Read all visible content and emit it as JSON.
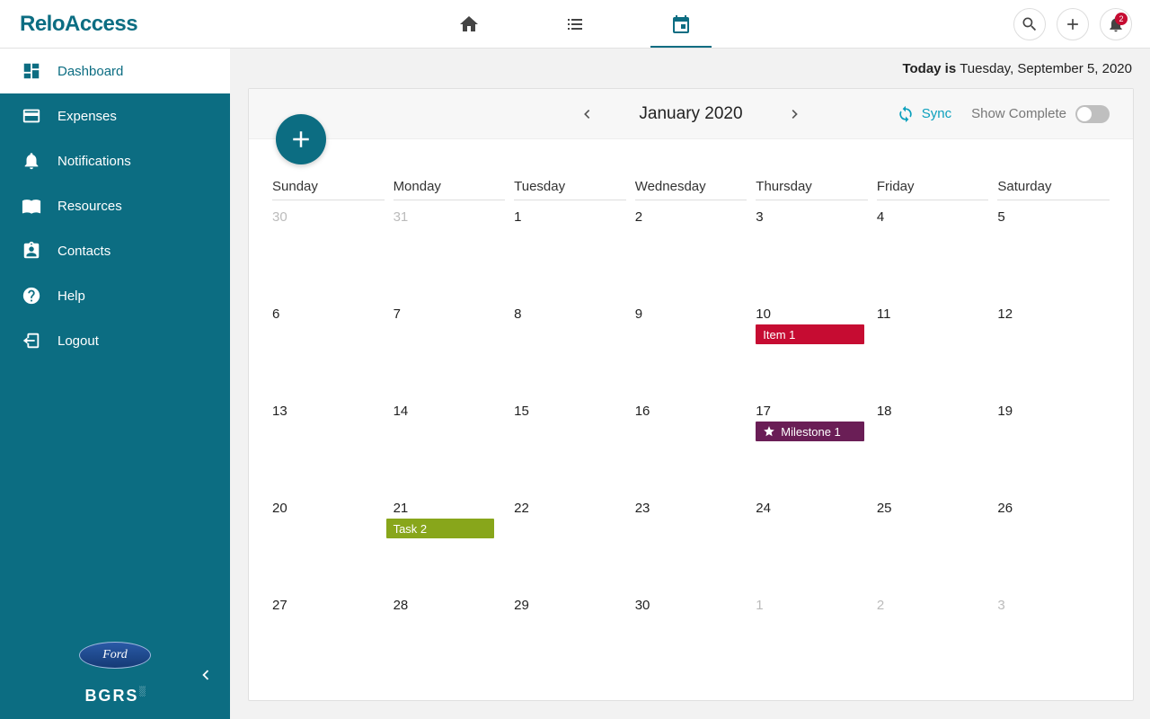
{
  "logo": "ReloAccess",
  "notifications_count": "2",
  "today_prefix": "Today is",
  "today_date": "Tuesday, September 5, 2020",
  "sidebar": {
    "items": [
      {
        "label": "Dashboard"
      },
      {
        "label": "Expenses"
      },
      {
        "label": "Notifications"
      },
      {
        "label": "Resources"
      },
      {
        "label": "Contacts"
      },
      {
        "label": "Help"
      },
      {
        "label": "Logout"
      }
    ],
    "ford": "Ford",
    "bgrs": "BGRS"
  },
  "calendar": {
    "month_label": "January 2020",
    "sync_label": "Sync",
    "show_complete_label": "Show Complete",
    "day_headers": [
      "Sunday",
      "Monday",
      "Tuesday",
      "Wednesday",
      "Thursday",
      "Friday",
      "Saturday"
    ],
    "weeks": [
      [
        {
          "n": "30",
          "muted": true
        },
        {
          "n": "31",
          "muted": true
        },
        {
          "n": "1"
        },
        {
          "n": "2"
        },
        {
          "n": "3"
        },
        {
          "n": "4"
        },
        {
          "n": "5"
        }
      ],
      [
        {
          "n": "6"
        },
        {
          "n": "7"
        },
        {
          "n": "8"
        },
        {
          "n": "9"
        },
        {
          "n": "10"
        },
        {
          "n": "11"
        },
        {
          "n": "12"
        }
      ],
      [
        {
          "n": "13"
        },
        {
          "n": "14"
        },
        {
          "n": "15"
        },
        {
          "n": "16"
        },
        {
          "n": "17"
        },
        {
          "n": "18"
        },
        {
          "n": "19"
        }
      ],
      [
        {
          "n": "20"
        },
        {
          "n": "21"
        },
        {
          "n": "22"
        },
        {
          "n": "23"
        },
        {
          "n": "24"
        },
        {
          "n": "25"
        },
        {
          "n": "26"
        }
      ],
      [
        {
          "n": "27"
        },
        {
          "n": "28"
        },
        {
          "n": "29"
        },
        {
          "n": "30"
        },
        {
          "n": "1",
          "muted": true
        },
        {
          "n": "2",
          "muted": true
        },
        {
          "n": "3",
          "muted": true
        }
      ]
    ],
    "events": {
      "item1": "Item 1",
      "milestone1": "Milestone 1",
      "task2": "Task 2"
    }
  },
  "colors": {
    "brand": "#0c6d82",
    "red": "#c60c32",
    "purple": "#6a1e56",
    "green": "#88a61b"
  }
}
